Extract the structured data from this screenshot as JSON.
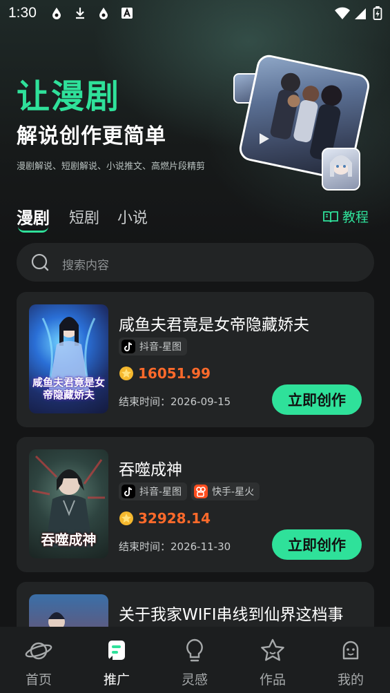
{
  "status_bar": {
    "time": "1:30"
  },
  "hero": {
    "title": "让漫剧",
    "subtitle": "解说创作更简单",
    "description": "漫剧解说、短剧解说、小说推文、高燃片段精剪"
  },
  "tabs": [
    {
      "label": "漫剧",
      "active": true
    },
    {
      "label": "短剧",
      "active": false
    },
    {
      "label": "小说",
      "active": false
    }
  ],
  "tutorial_label": "教程",
  "search": {
    "placeholder": "搜索内容"
  },
  "cards": [
    {
      "title": "咸鱼夫君竟是女帝隐藏娇夫",
      "cover_text": "咸鱼夫君竟是女帝隐藏娇夫",
      "platforms": [
        "抖音-星图"
      ],
      "price": "16051.99",
      "end_time": "结束时间：2026-09-15",
      "button": "立即创作"
    },
    {
      "title": "吞噬成神",
      "cover_text": "吞噬成神",
      "platforms": [
        "抖音-星图",
        "快手-星火"
      ],
      "price": "32928.14",
      "end_time": "结束时间：2026-11-30",
      "button": "立即创作"
    },
    {
      "title": "关于我家WIFI串线到仙界这档事"
    }
  ],
  "bottom_nav": [
    {
      "label": "首页",
      "icon": "planet-icon"
    },
    {
      "label": "推广",
      "icon": "promote-icon",
      "active": true
    },
    {
      "label": "灵感",
      "icon": "lightbulb-icon"
    },
    {
      "label": "作品",
      "icon": "star-badge-icon"
    },
    {
      "label": "我的",
      "icon": "profile-icon"
    }
  ],
  "colors": {
    "accent": "#2fe19a",
    "price": "#ff6a2b",
    "background": "#141516",
    "card": "#222425"
  }
}
